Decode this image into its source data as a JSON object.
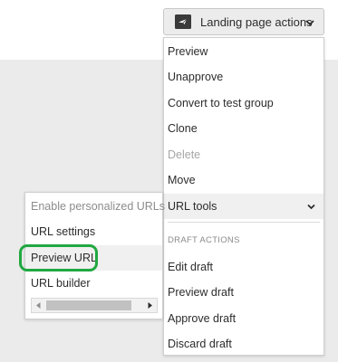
{
  "toolbar": {
    "actions_label": "Landing page actions",
    "icon": "landing-page-icon",
    "dropdown_icon": "chevron-down-icon"
  },
  "menu": {
    "items": [
      {
        "label": "Preview",
        "enabled": true
      },
      {
        "label": "Unapprove",
        "enabled": true
      },
      {
        "label": "Convert to test group",
        "enabled": true
      },
      {
        "label": "Clone",
        "enabled": true
      },
      {
        "label": "Delete",
        "enabled": false
      },
      {
        "label": "Move",
        "enabled": true
      },
      {
        "label": "URL tools",
        "enabled": true,
        "submenu": true
      }
    ],
    "draft_section_title": "DRAFT ACTIONS",
    "draft_items": [
      {
        "label": "Edit draft"
      },
      {
        "label": "Preview draft"
      },
      {
        "label": "Approve draft"
      },
      {
        "label": "Discard draft"
      }
    ]
  },
  "submenu": {
    "items": [
      {
        "label": "Enable personalized URLs",
        "enabled": false
      },
      {
        "label": "URL settings",
        "enabled": true
      },
      {
        "label": "Preview URL",
        "enabled": true,
        "highlighted": true
      },
      {
        "label": "URL builder",
        "enabled": true
      }
    ]
  },
  "colors": {
    "highlight_ring": "#20a840",
    "page_background": "#ebebeb",
    "disabled_text": "#a6a6a6"
  }
}
